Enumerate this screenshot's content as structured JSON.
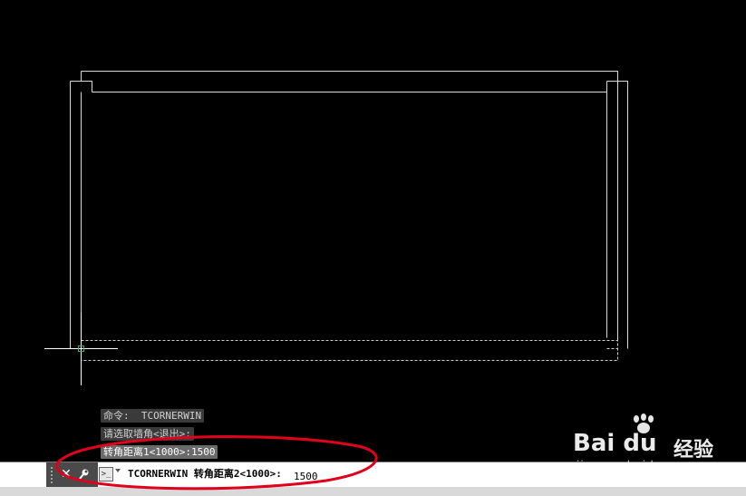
{
  "command_history": {
    "line1": "命令:  TCORNERWIN",
    "line2": "请选取墙角<退出>:",
    "line3": "转角距离1<1000>:1500"
  },
  "command_bar": {
    "prompt": "TCORNERWIN 转角距离2<1000>:",
    "input_value": "1500",
    "close_icon": "x-icon",
    "settings_icon": "wrench-icon",
    "prompt_icon": "command-prompt-icon"
  },
  "watermark": {
    "logo_text": "Bai du",
    "logo_cn": "经验",
    "url": "jingyan.baidu.com"
  },
  "colors": {
    "canvas_bg": "#000000",
    "geometry_line": "#ffffff",
    "crosshair": "#ffffff",
    "annotation": "#e0001b"
  }
}
